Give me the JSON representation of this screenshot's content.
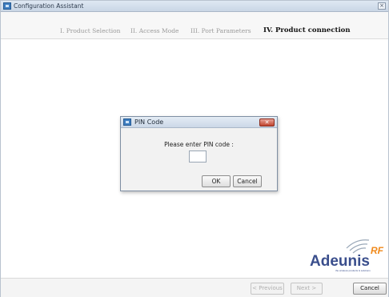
{
  "window": {
    "title": "Configuration Assistant",
    "close_glyph": "×"
  },
  "steps": [
    {
      "label": "I. Product Selection",
      "active": false
    },
    {
      "label": "II. Access Mode",
      "active": false
    },
    {
      "label": "III. Port Parameters",
      "active": false
    },
    {
      "label": "IV. Product connection",
      "active": true
    }
  ],
  "dialog": {
    "title": "PIN Code",
    "close_glyph": "✕",
    "prompt": "Please enter PIN code :",
    "pin_value": "",
    "ok_label": "OK",
    "cancel_label": "Cancel"
  },
  "logo": {
    "text": "Adeunis",
    "suffix": "RF",
    "tagline": "the wireless products & solutions",
    "brand_color": "#f08a1c",
    "text_color": "#3a4e8c"
  },
  "footer": {
    "previous_label": "< Previous",
    "next_label": "Next >",
    "cancel_label": "Cancel"
  }
}
